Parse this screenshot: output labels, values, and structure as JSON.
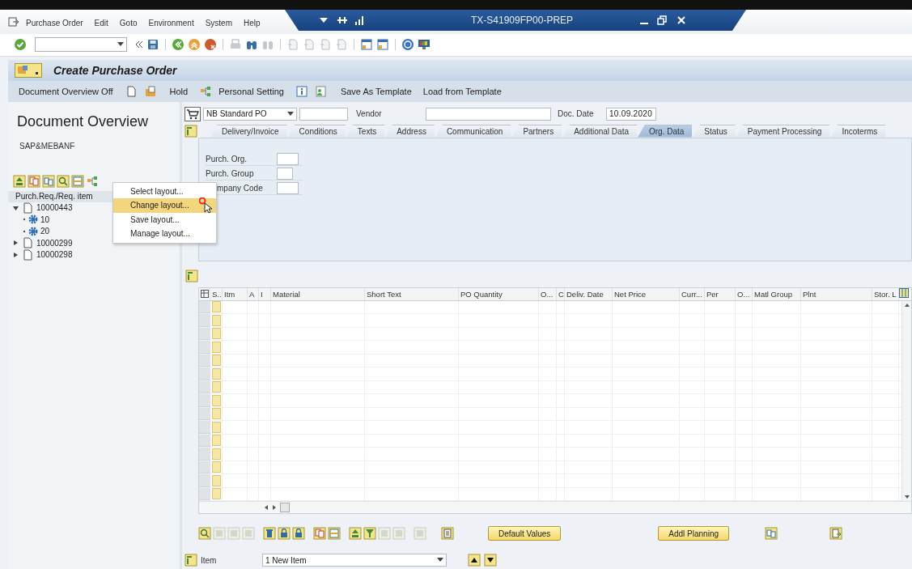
{
  "menu_bar": {
    "items": [
      "Purchase Order",
      "Edit",
      "Goto",
      "Environment",
      "System",
      "Help"
    ]
  },
  "window": {
    "title": "TX-S41909FP00-PREP"
  },
  "screen_title": "Create Purchase Order",
  "app_toolbar": {
    "buttons": [
      "Document Overview Off",
      "Hold",
      "Personal Setting",
      "Save As Template",
      "Load from Template"
    ]
  },
  "document_overview": {
    "title": "Document Overview",
    "layout": "SAP&MEBANF",
    "column_header": "Purch.Req./Req. item",
    "tree": [
      {
        "label": "10000443",
        "expanded": true,
        "children": [
          {
            "label": "10"
          },
          {
            "label": "20"
          }
        ]
      },
      {
        "label": "10000299",
        "expanded": false
      },
      {
        "label": "10000298",
        "expanded": false
      }
    ]
  },
  "context_menu": [
    {
      "label": "Select layout...",
      "selected": false
    },
    {
      "label": "Change layout...",
      "selected": true
    },
    {
      "label": "Save layout...",
      "selected": false
    },
    {
      "label": "Manage layout..."
    }
  ],
  "header": {
    "order_type": "NB Standard PO",
    "vendor_label": "Vendor",
    "doc_date_label": "Doc. Date",
    "doc_date": "10.09.2020"
  },
  "tabs": [
    {
      "label": "Delivery/Invoice",
      "selected": false
    },
    {
      "label": "Conditions",
      "selected": false
    },
    {
      "label": "Texts",
      "selected": false
    },
    {
      "label": "Address",
      "selected": false
    },
    {
      "label": "Communication",
      "selected": false
    },
    {
      "label": "Partners",
      "selected": false
    },
    {
      "label": "Additional Data",
      "selected": false
    },
    {
      "label": "Org. Data",
      "selected": true
    },
    {
      "label": "Status",
      "selected": false
    },
    {
      "label": "Payment Processing",
      "selected": false
    },
    {
      "label": "Incoterms",
      "selected": false
    }
  ],
  "org_data": {
    "fields": [
      {
        "label": "Purch. Org."
      },
      {
        "label": "Purch. Group"
      },
      {
        "label": "mpany Code"
      }
    ]
  },
  "items_grid": {
    "columns": [
      "S..",
      "Itm",
      "A",
      "I",
      "Material",
      "Short Text",
      "PO Quantity",
      "O...",
      "C",
      "Deliv. Date",
      "Net Price",
      "Curr...",
      "Per",
      "O...",
      "Matl Group",
      "Plnt",
      "Stor. L"
    ]
  },
  "bottom_buttons": [
    "Default Values",
    "Addl Planning"
  ],
  "item_selector": {
    "label": "Item",
    "value": "1 New Item"
  }
}
